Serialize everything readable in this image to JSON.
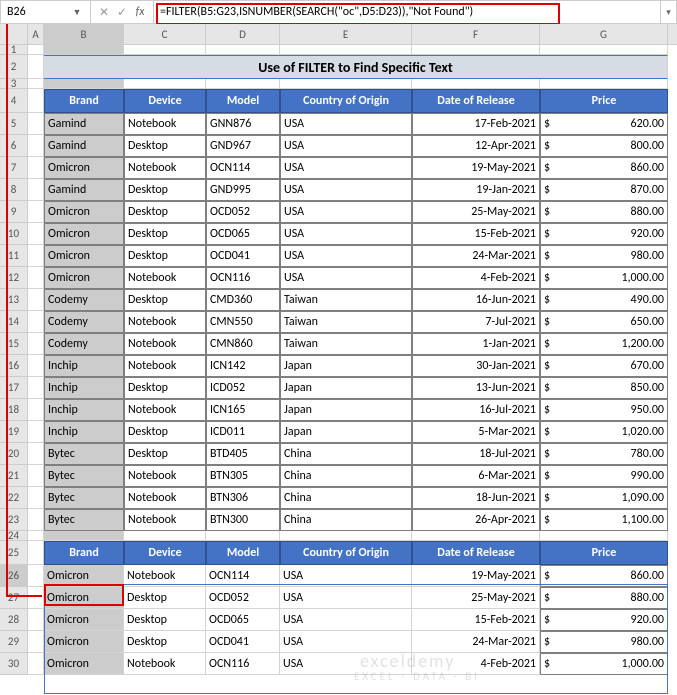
{
  "namebox": "B26",
  "formula": "=FILTER(B5:G23,ISNUMBER(SEARCH(\"oc\",D5:D23)),\"Not Found\")",
  "cols": [
    "A",
    "B",
    "C",
    "D",
    "E",
    "F",
    "G"
  ],
  "title": "Use of FILTER to Find Specific Text",
  "headers": [
    "Brand",
    "Device",
    "Model",
    "Country of Origin",
    "Date of Release",
    "Price"
  ],
  "data": [
    {
      "brand": "Gamind",
      "device": "Notebook",
      "model": "GNN876",
      "country": "USA",
      "date": "17-Feb-2021",
      "price": "620.00"
    },
    {
      "brand": "Gamind",
      "device": "Desktop",
      "model": "GND967",
      "country": "USA",
      "date": "12-Apr-2021",
      "price": "800.00"
    },
    {
      "brand": "Omicron",
      "device": "Notebook",
      "model": "OCN114",
      "country": "USA",
      "date": "19-May-2021",
      "price": "860.00"
    },
    {
      "brand": "Gamind",
      "device": "Desktop",
      "model": "GND995",
      "country": "USA",
      "date": "19-Jan-2021",
      "price": "870.00"
    },
    {
      "brand": "Omicron",
      "device": "Desktop",
      "model": "OCD052",
      "country": "USA",
      "date": "25-May-2021",
      "price": "880.00"
    },
    {
      "brand": "Omicron",
      "device": "Desktop",
      "model": "OCD065",
      "country": "USA",
      "date": "15-Feb-2021",
      "price": "920.00"
    },
    {
      "brand": "Omicron",
      "device": "Desktop",
      "model": "OCD041",
      "country": "USA",
      "date": "24-Mar-2021",
      "price": "980.00"
    },
    {
      "brand": "Omicron",
      "device": "Notebook",
      "model": "OCN116",
      "country": "USA",
      "date": "4-Feb-2021",
      "price": "1,000.00"
    },
    {
      "brand": "Codemy",
      "device": "Desktop",
      "model": "CMD360",
      "country": "Taiwan",
      "date": "16-Jun-2021",
      "price": "490.00"
    },
    {
      "brand": "Codemy",
      "device": "Notebook",
      "model": "CMN550",
      "country": "Taiwan",
      "date": "7-Jul-2021",
      "price": "650.00"
    },
    {
      "brand": "Codemy",
      "device": "Notebook",
      "model": "CMN860",
      "country": "Taiwan",
      "date": "1-Jan-2021",
      "price": "1,200.00"
    },
    {
      "brand": "Inchip",
      "device": "Notebook",
      "model": "ICN142",
      "country": "Japan",
      "date": "30-Jan-2021",
      "price": "670.00"
    },
    {
      "brand": "Inchip",
      "device": "Desktop",
      "model": "ICD052",
      "country": "Japan",
      "date": "13-Jun-2021",
      "price": "850.00"
    },
    {
      "brand": "Inchip",
      "device": "Notebook",
      "model": "ICN165",
      "country": "Japan",
      "date": "16-Jul-2021",
      "price": "950.00"
    },
    {
      "brand": "Inchip",
      "device": "Desktop",
      "model": "ICD011",
      "country": "Japan",
      "date": "5-Mar-2021",
      "price": "1,020.00"
    },
    {
      "brand": "Bytec",
      "device": "Desktop",
      "model": "BTD405",
      "country": "China",
      "date": "18-Jul-2021",
      "price": "780.00"
    },
    {
      "brand": "Bytec",
      "device": "Notebook",
      "model": "BTN305",
      "country": "China",
      "date": "6-Mar-2021",
      "price": "990.00"
    },
    {
      "brand": "Bytec",
      "device": "Notebook",
      "model": "BTN306",
      "country": "China",
      "date": "18-Jun-2021",
      "price": "1,090.00"
    },
    {
      "brand": "Bytec",
      "device": "Notebook",
      "model": "BTN300",
      "country": "China",
      "date": "26-Apr-2021",
      "price": "1,100.00"
    }
  ],
  "result": [
    {
      "brand": "Omicron",
      "device": "Notebook",
      "model": "OCN114",
      "country": "USA",
      "date": "19-May-2021",
      "price": "860.00"
    },
    {
      "brand": "Omicron",
      "device": "Desktop",
      "model": "OCD052",
      "country": "USA",
      "date": "25-May-2021",
      "price": "880.00"
    },
    {
      "brand": "Omicron",
      "device": "Desktop",
      "model": "OCD065",
      "country": "USA",
      "date": "15-Feb-2021",
      "price": "920.00"
    },
    {
      "brand": "Omicron",
      "device": "Desktop",
      "model": "OCD041",
      "country": "USA",
      "date": "24-Mar-2021",
      "price": "980.00"
    },
    {
      "brand": "Omicron",
      "device": "Notebook",
      "model": "OCN116",
      "country": "USA",
      "date": "4-Feb-2021",
      "price": "1,000.00"
    }
  ],
  "watermark1": "exceldemy",
  "watermark2": "EXCEL - DATA - BI"
}
